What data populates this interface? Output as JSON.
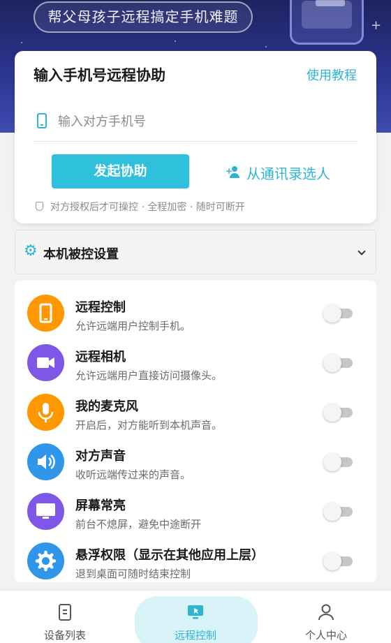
{
  "banner": {
    "slogan": "帮父母孩子远程搞定手机难题"
  },
  "card": {
    "title": "输入手机号远程协助",
    "tutorial_link": "使用教程",
    "phone_placeholder": "输入对方手机号",
    "phone_value": "",
    "start_button": "发起协助",
    "contacts_button": "从通讯录选人",
    "security_note": "对方授权后才可操控 · 全程加密 · 随时可断开"
  },
  "settings": {
    "title": "本机被控设置",
    "items": [
      {
        "name": "远程控制",
        "desc": "允许远端用户控制手机。",
        "icon": "phone-icon",
        "color": "#ff9800",
        "enabled": false
      },
      {
        "name": "远程相机",
        "desc": "允许远端用户直接访问摄像头。",
        "icon": "video-camera-icon",
        "color": "#7e57e6",
        "enabled": false
      },
      {
        "name": "我的麦克风",
        "desc": "开启后，对方能听到本机声音。",
        "icon": "microphone-icon",
        "color": "#ff9800",
        "enabled": false
      },
      {
        "name": "对方声音",
        "desc": "收听远端传过来的声音。",
        "icon": "speaker-icon",
        "color": "#2f96ea",
        "enabled": false
      },
      {
        "name": "屏幕常亮",
        "desc": "前台不熄屏，避免中途断开",
        "icon": "monitor-icon",
        "color": "#7e57e6",
        "enabled": false
      },
      {
        "name": "悬浮权限（显示在其他应用上层）",
        "desc": "退到桌面可随时结束控制",
        "icon": "gear-icon",
        "color": "#2f96ea",
        "enabled": false
      }
    ]
  },
  "bottom_nav": {
    "items": [
      {
        "label": "设备列表",
        "icon": "device-list-icon",
        "active": false
      },
      {
        "label": "远程控制",
        "icon": "remote-control-icon",
        "active": true
      },
      {
        "label": "个人中心",
        "icon": "profile-icon",
        "active": false
      }
    ]
  },
  "colors": {
    "accent": "#2fb4d4",
    "button": "#2fc1dc",
    "banner": "#2c3591"
  }
}
